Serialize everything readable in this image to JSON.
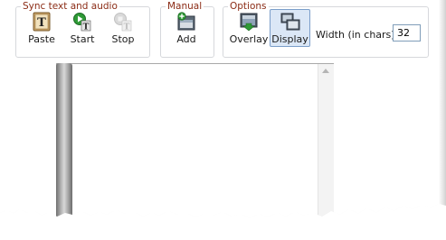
{
  "groups": {
    "sync": {
      "title": "Sync text and audio",
      "buttons": [
        {
          "label": "Paste",
          "icon": "text-t-icon",
          "state": "enabled"
        },
        {
          "label": "Start",
          "icon": "play-text-icon",
          "state": "enabled"
        },
        {
          "label": "Stop",
          "icon": "stop-text-icon",
          "state": "disabled"
        }
      ]
    },
    "manual": {
      "title": "Manual",
      "buttons": [
        {
          "label": "Add",
          "icon": "add-frame-icon",
          "state": "enabled"
        }
      ]
    },
    "options": {
      "title": "Options",
      "buttons": [
        {
          "label": "Overlay",
          "icon": "overlay-icon",
          "state": "enabled"
        },
        {
          "label": "Display",
          "icon": "display-icon",
          "state": "pressed"
        }
      ],
      "width_label": "Width (in chars):",
      "width_value": "32"
    }
  },
  "colors": {
    "group_title": "#8b2c16",
    "pressed_bg": "#dbe7f6",
    "pressed_border": "#7b9ec9"
  }
}
